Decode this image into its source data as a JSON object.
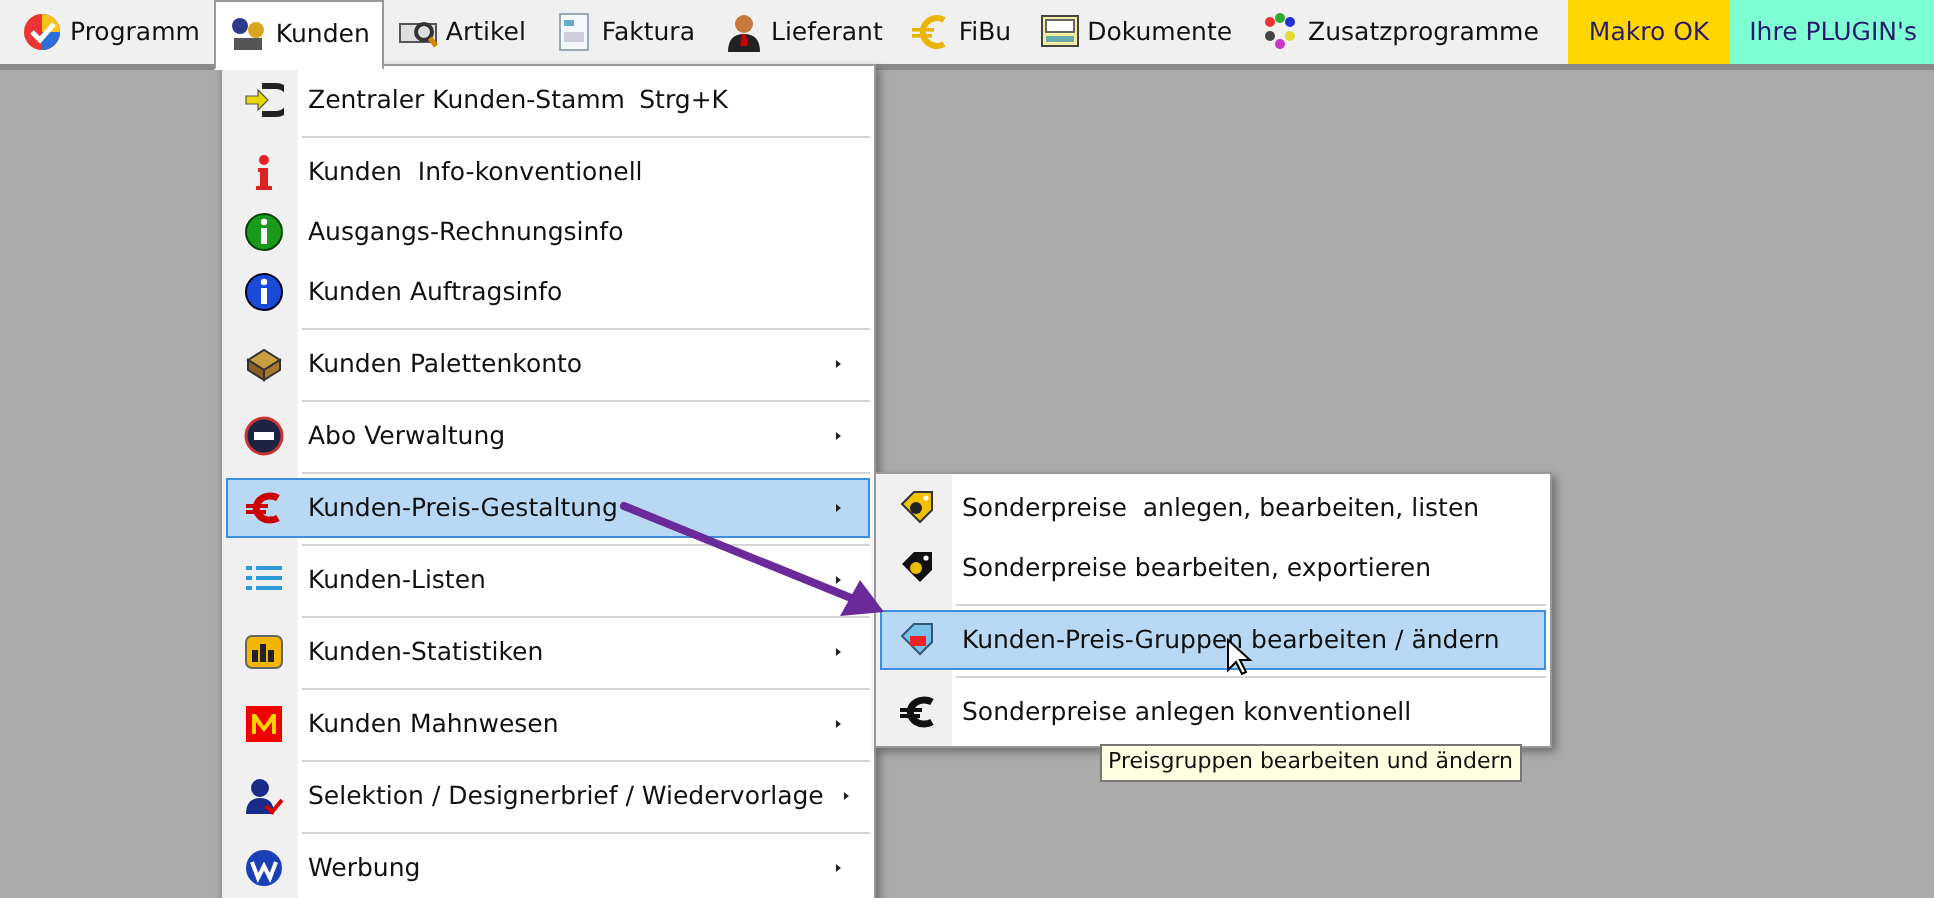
{
  "menubar": {
    "items": [
      {
        "label": "Programm",
        "selected": false
      },
      {
        "label": "Kunden",
        "selected": true
      },
      {
        "label": "Artikel",
        "selected": false
      },
      {
        "label": "Faktura",
        "selected": false
      },
      {
        "label": "Lieferant",
        "selected": false
      },
      {
        "label": "FiBu",
        "selected": false
      },
      {
        "label": "Dokumente",
        "selected": false
      },
      {
        "label": "Zusatzprogramme",
        "selected": false
      }
    ],
    "badges": [
      {
        "label": "Makro OK",
        "color": "#ffd700"
      },
      {
        "label": "Ihre PLUGIN's",
        "color": "#7fffd4"
      }
    ]
  },
  "menu": {
    "groups": [
      {
        "items": [
          {
            "label": "Zentraler Kunden-Stamm",
            "shortcut": "Strg+K",
            "submenu": false,
            "selected": false
          }
        ]
      },
      {
        "items": [
          {
            "label": "Kunden  Info-konventionell",
            "submenu": false,
            "selected": false
          },
          {
            "label": "Ausgangs-Rechnungsinfo",
            "submenu": false,
            "selected": false
          },
          {
            "label": "Kunden Auftragsinfo",
            "submenu": false,
            "selected": false
          }
        ]
      },
      {
        "items": [
          {
            "label": "Kunden Palettenkonto",
            "submenu": true,
            "selected": false
          }
        ]
      },
      {
        "items": [
          {
            "label": "Abo Verwaltung",
            "submenu": true,
            "selected": false
          }
        ]
      },
      {
        "items": [
          {
            "label": "Kunden-Preis-Gestaltung",
            "submenu": true,
            "selected": true
          }
        ]
      },
      {
        "items": [
          {
            "label": "Kunden-Listen",
            "submenu": true,
            "selected": false
          }
        ]
      },
      {
        "items": [
          {
            "label": "Kunden-Statistiken",
            "submenu": true,
            "selected": false
          }
        ]
      },
      {
        "items": [
          {
            "label": "Kunden Mahnwesen",
            "submenu": true,
            "selected": false
          }
        ]
      },
      {
        "items": [
          {
            "label": "Selektion / Designerbrief / Wiedervorlage",
            "submenu": true,
            "selected": false
          }
        ]
      },
      {
        "items": [
          {
            "label": "Werbung",
            "submenu": true,
            "selected": false
          }
        ]
      }
    ]
  },
  "submenu": {
    "groups": [
      {
        "items": [
          {
            "label": "Sonderpreise  anlegen, bearbeiten, listen",
            "selected": false
          },
          {
            "label": "Sonderpreise bearbeiten, exportieren",
            "selected": false
          }
        ]
      },
      {
        "items": [
          {
            "label": "Kunden-Preis-Gruppen bearbeiten / ändern",
            "selected": true
          }
        ]
      },
      {
        "items": [
          {
            "label": "Sonderpreise anlegen konventionell",
            "selected": false
          }
        ]
      }
    ]
  },
  "tooltip": {
    "text": "Preisgruppen bearbeiten und ändern"
  }
}
